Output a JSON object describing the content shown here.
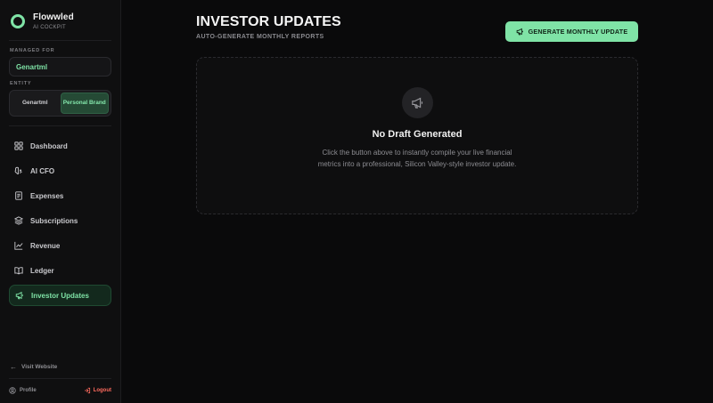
{
  "brand": {
    "name": "Flowwled",
    "subtitle": "AI COCKPIT"
  },
  "sidebar": {
    "managed_for_label": "MANAGED FOR",
    "managed_for_value": "Genartml",
    "entity_label": "ENTITY",
    "entity_options": [
      {
        "label": "Genartml"
      },
      {
        "label": "Personal Brand"
      }
    ],
    "nav": [
      {
        "label": "Dashboard",
        "icon": "grid-icon"
      },
      {
        "label": "AI CFO",
        "icon": "brain-icon"
      },
      {
        "label": "Expenses",
        "icon": "receipt-icon"
      },
      {
        "label": "Subscriptions",
        "icon": "layers-icon"
      },
      {
        "label": "Revenue",
        "icon": "trend-icon"
      },
      {
        "label": "Ledger",
        "icon": "book-icon"
      },
      {
        "label": "Investor Updates",
        "icon": "megaphone-icon"
      }
    ],
    "visit_website": "Visit Website",
    "profile": "Profile",
    "logout": "Logout"
  },
  "page": {
    "title": "INVESTOR UPDATES",
    "subtitle": "AUTO-GENERATE MONTHLY REPORTS",
    "generate_button": "GENERATE MONTHLY UPDATE",
    "empty_title": "No Draft Generated",
    "empty_description": "Click the button above to instantly compile your live financial metrics into a professional, Silicon Valley-style investor update."
  },
  "colors": {
    "accent": "#7fe3a6",
    "background": "#0a0a0b",
    "logout": "#ff6b5e"
  }
}
